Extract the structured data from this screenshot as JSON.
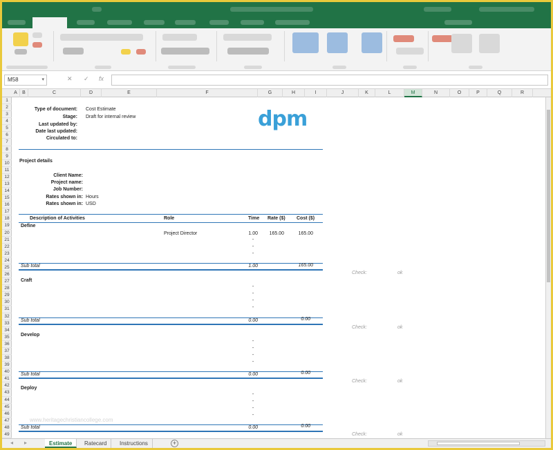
{
  "namebox": {
    "cell": "M58"
  },
  "formula": {
    "cancel": "✕",
    "enter": "✓",
    "fx": "fx"
  },
  "columns": [
    "A",
    "B",
    "C",
    "D",
    "E",
    "F",
    "G",
    "H",
    "I",
    "J",
    "K",
    "L",
    "M",
    "N",
    "O",
    "P",
    "Q",
    "R"
  ],
  "selected_column": "M",
  "rows": [
    "1",
    "2",
    "3",
    "4",
    "5",
    "6",
    "7",
    "8",
    "9",
    "10",
    "11",
    "12",
    "13",
    "14",
    "15",
    "16",
    "17",
    "18",
    "19",
    "20",
    "21",
    "22",
    "23",
    "24",
    "25",
    "26",
    "27",
    "28",
    "29",
    "30",
    "31",
    "32",
    "33",
    "34",
    "35",
    "36",
    "37",
    "38",
    "39",
    "40",
    "41",
    "42",
    "43",
    "44",
    "45",
    "46",
    "47",
    "48",
    "49"
  ],
  "doc": {
    "type_label": "Type of document:",
    "type_value": "Cost Estimate",
    "stage_label": "Stage:",
    "stage_value": "Draft for internal review",
    "last_updated_by": "Last updated by:",
    "date_last_updated": "Date last updated:",
    "circulated_to": "Circulated to:",
    "logo": "dpm"
  },
  "project": {
    "heading": "Project details",
    "client": "Client Name:",
    "name": "Project name:",
    "job": "Job Number:",
    "rates_label": "Rates shown in:",
    "rates_value": "Hours",
    "rates2_label": "Rates shown in:",
    "rates2_value": "USD"
  },
  "table": {
    "h_desc": "Description of Activities",
    "h_role": "Role",
    "h_time": "Time",
    "h_rate": "Rate ($)",
    "h_cost": "Cost ($)"
  },
  "sections": [
    {
      "name": "Define",
      "role": "Project Director",
      "time": "1.00",
      "rate": "165.00",
      "cost": "165.00",
      "dashes": [
        "-",
        "-",
        "-"
      ],
      "subtotal": "Sub total",
      "sub_time": "1.00",
      "sub_cost": "165.00",
      "check": "Check:",
      "ok": "ok"
    },
    {
      "name": "Craft",
      "dashes": [
        "-",
        "-",
        "-",
        "-"
      ],
      "subtotal": "Sub total",
      "sub_time": "0.00",
      "sub_cost": "0.00",
      "check": "Check:",
      "ok": "ok"
    },
    {
      "name": "Develop",
      "dashes": [
        "-",
        "-",
        "-",
        "-"
      ],
      "subtotal": "Sub total",
      "sub_time": "0.00",
      "sub_cost": "0.00",
      "check": "Check:",
      "ok": "ok"
    },
    {
      "name": "Deploy",
      "dashes": [
        "-",
        "-",
        "-",
        "-"
      ],
      "subtotal": "Sub total",
      "sub_time": "0.00",
      "sub_cost": "0.00",
      "check": "Check:",
      "ok": "ok"
    }
  ],
  "watermark": "www.heritagechristiancollege.com",
  "sheet_tabs": [
    "Estimate",
    "Ratecard",
    "Instructions"
  ],
  "active_tab": "Estimate",
  "add_sheet": "+",
  "colors": {
    "excel_green": "#217346",
    "rule_blue": "#2e75b6",
    "logo_blue": "#3aa0d8"
  }
}
